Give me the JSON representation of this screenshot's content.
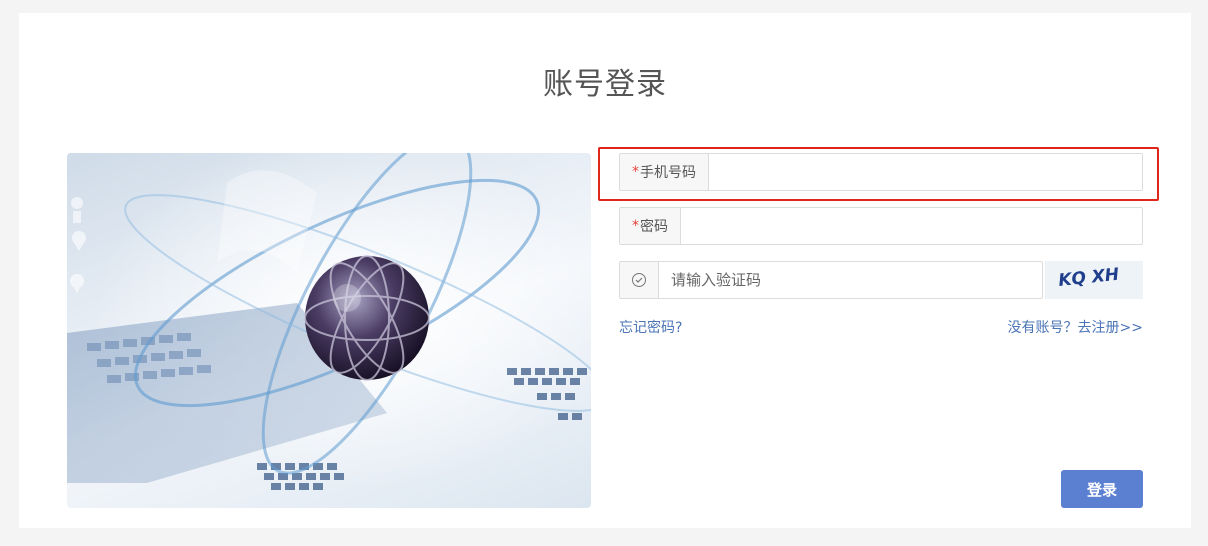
{
  "page": {
    "title": "账号登录"
  },
  "form": {
    "phone": {
      "required_mark": "*",
      "label": "手机号码",
      "value": ""
    },
    "password": {
      "required_mark": "*",
      "label": "密码",
      "value": ""
    },
    "captcha": {
      "placeholder": "请输入验证码",
      "value": "",
      "image_text": "KQ XH"
    },
    "forgot_link": "忘记密码?",
    "register_link": "没有账号？去注册>>",
    "submit_label": "登录"
  },
  "colors": {
    "accent": "#5b7fd1",
    "link": "#4a74b5",
    "required": "#e5413b",
    "highlight_border": "#e0261b"
  }
}
